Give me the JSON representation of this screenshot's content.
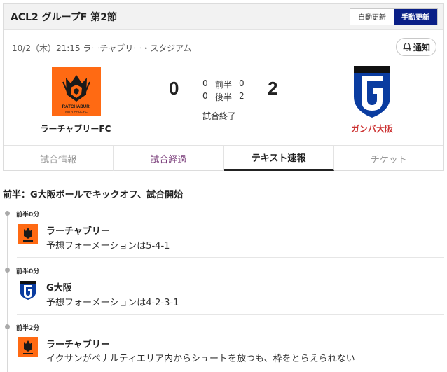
{
  "header": {
    "title": "ACL2 グループF 第2節",
    "auto_update": "自動更新",
    "manual_update": "手動更新"
  },
  "match": {
    "datetime_venue": "10/2（木）21:15 ラーチャブリー・スタジアム",
    "notify_label": "通知",
    "home_team": "ラーチャブリーFC",
    "away_team": "ガンバ大阪",
    "home_score": "0",
    "away_score": "2",
    "first_half_label": "前半",
    "second_half_label": "後半",
    "home_first": "0",
    "away_first": "0",
    "home_second": "0",
    "away_second": "2",
    "status": "試合終了"
  },
  "tabs": [
    "試合情報",
    "試合経過",
    "テキスト速報",
    "チケット"
  ],
  "active_tab": "テキスト速報",
  "section_heading": "前半：G大阪ボールでキックオフ、試合開始",
  "events": [
    {
      "time": "前半0分",
      "team": "ラーチャブリー",
      "text": "予想フォーメーションは5-4-1",
      "side": "home"
    },
    {
      "time": "前半0分",
      "team": "G大阪",
      "text": "予想フォーメーションは4-2-3-1",
      "side": "away"
    },
    {
      "time": "前半2分",
      "team": "ラーチャブリー",
      "text": "イクサンがペナルティエリア内からシュートを放つも、枠をとらえられない",
      "side": "home"
    }
  ],
  "colors": {
    "manual_bg": "#0a1f87",
    "home_brand": "#ff6a13",
    "away_brand": "#0a3ca0",
    "away_name": "#cc3333"
  },
  "logo_text": {
    "home_crest_line1": "RATCHABURI",
    "home_crest_line2": "MITR PHOL FC"
  }
}
